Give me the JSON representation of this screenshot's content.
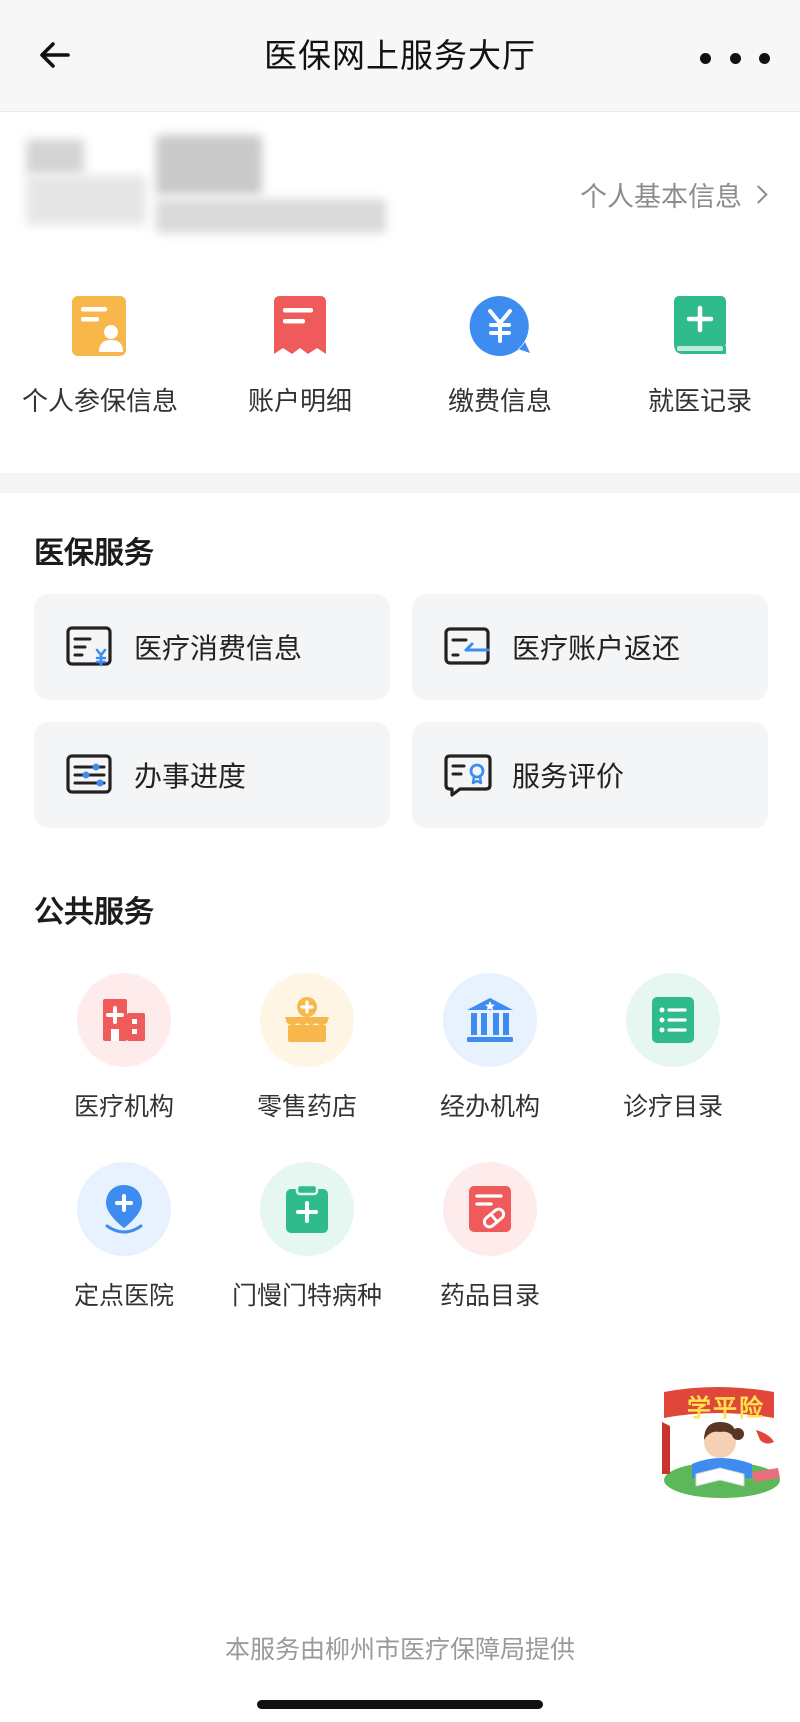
{
  "header": {
    "title": "医保网上服务大厅"
  },
  "profile": {
    "basic_info_label": "个人基本信息"
  },
  "quick_actions": [
    {
      "label": "个人参保信息",
      "icon": "insurance-card-icon"
    },
    {
      "label": "账户明细",
      "icon": "receipt-icon"
    },
    {
      "label": "缴费信息",
      "icon": "yuan-payment-icon"
    },
    {
      "label": "就医记录",
      "icon": "medical-record-book-icon"
    }
  ],
  "medical_services": {
    "title": "医保服务",
    "items": [
      {
        "label": "医疗消费信息",
        "icon": "consumption-info-icon"
      },
      {
        "label": "医疗账户返还",
        "icon": "account-refund-icon"
      },
      {
        "label": "办事进度",
        "icon": "progress-icon"
      },
      {
        "label": "服务评价",
        "icon": "service-evaluation-icon"
      }
    ]
  },
  "public_services": {
    "title": "公共服务",
    "items": [
      {
        "label": "医疗机构",
        "icon": "hospital-building-icon"
      },
      {
        "label": "零售药店",
        "icon": "pharmacy-icon"
      },
      {
        "label": "经办机构",
        "icon": "government-building-icon"
      },
      {
        "label": "诊疗目录",
        "icon": "list-catalog-icon"
      },
      {
        "label": "定点医院",
        "icon": "location-pin-icon"
      },
      {
        "label": "门慢门特病种",
        "icon": "clipboard-plus-icon"
      },
      {
        "label": "药品目录",
        "icon": "medicine-catalog-icon"
      }
    ]
  },
  "floating_badge": {
    "text": "学平险"
  },
  "footer": {
    "note": "本服务由柳州市医疗保障局提供"
  },
  "colors": {
    "orange": "#f8b74a",
    "red": "#ef5a5a",
    "blue": "#3f8cf0",
    "green": "#2fbb8c",
    "card_bg": "#f4f5f7"
  }
}
